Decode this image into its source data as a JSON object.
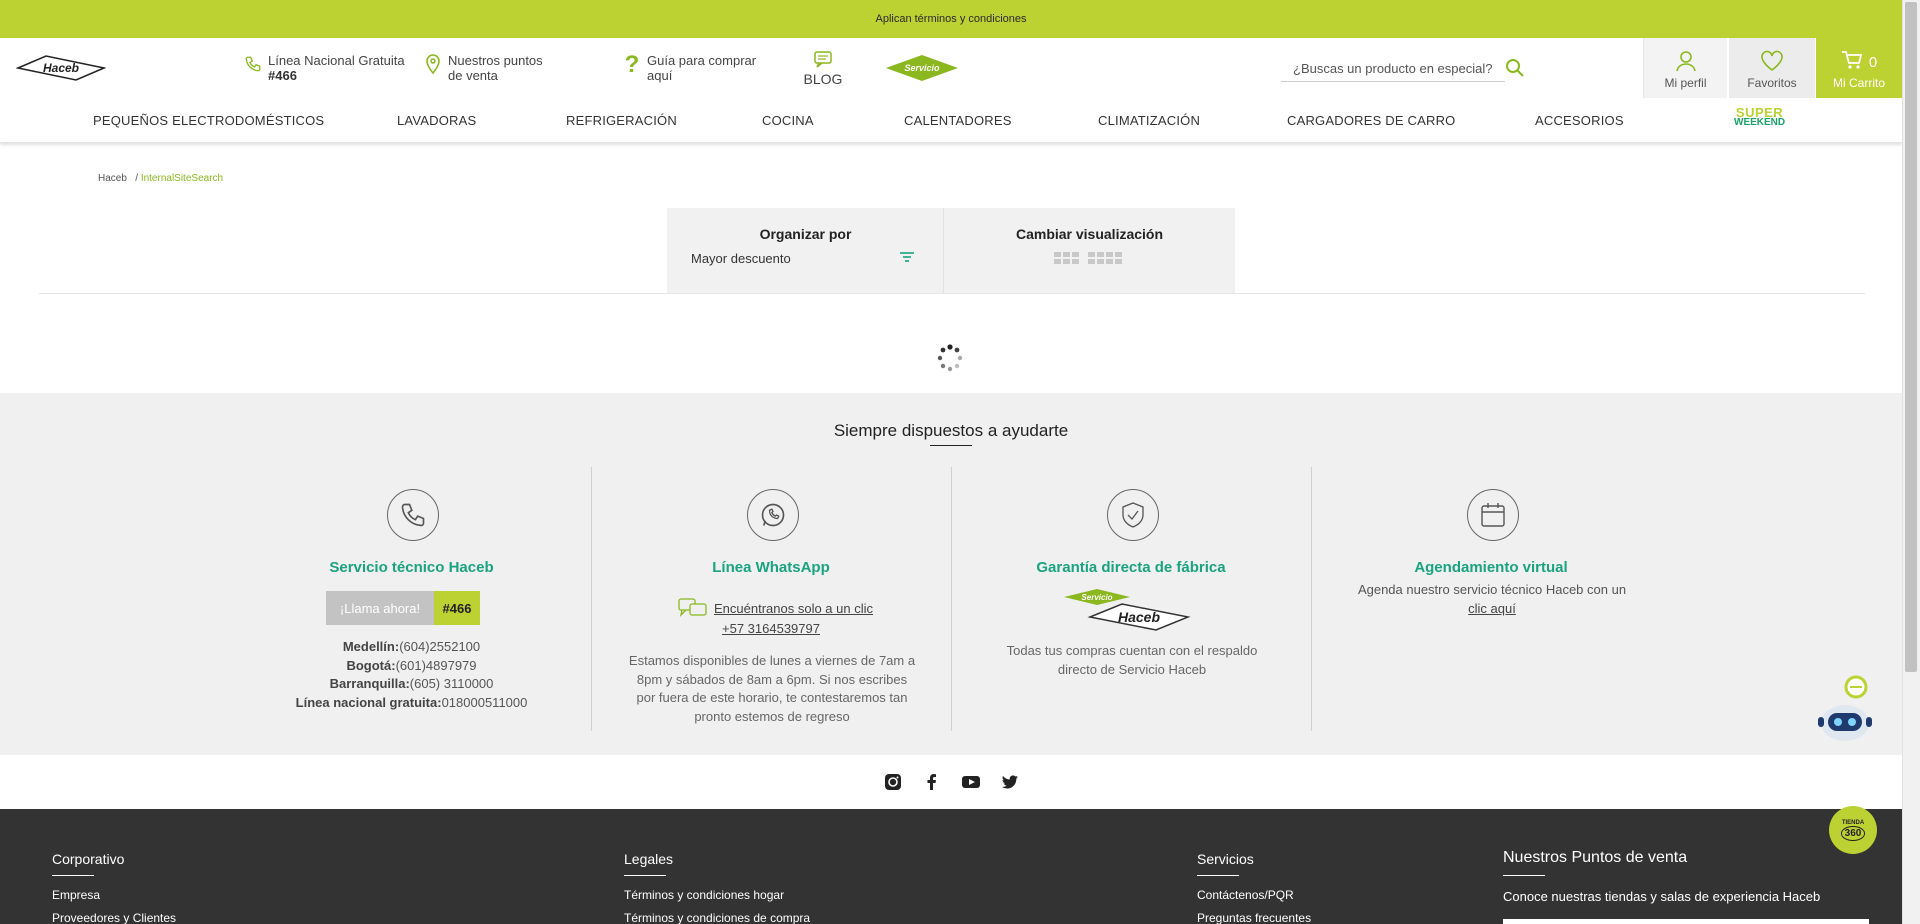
{
  "topbar": {
    "text": "Aplican términos y condiciones"
  },
  "header": {
    "logo_text": "Haceb",
    "linea_line1": "Línea Nacional Gratuita",
    "linea_line2": "#466",
    "puntos_line1": "Nuestros puntos",
    "puntos_line2": "de venta",
    "guia_line1": "Guía para comprar",
    "guia_line2": "aquí",
    "blog": "BLOG",
    "servicio_badge": "Servicio",
    "search_placeholder": "¿Buscas un producto en especial?",
    "perfil": "Mi perfil",
    "favoritos": "Favoritos",
    "cart_count": "0",
    "cart_label": "Mi Carrito"
  },
  "nav": {
    "items": [
      "PEQUEÑOS ELECTRODOMÉSTICOS",
      "LAVADORAS",
      "REFRIGERACIÓN",
      "COCINA",
      "CALENTADORES",
      "CLIMATIZACIÓN",
      "CARGADORES DE CARRO",
      "ACCESORIOS"
    ],
    "super_line1": "SUPER",
    "super_line2": "WEEKEND"
  },
  "breadcrumb": {
    "home": "Haceb",
    "separator": "/",
    "current": "InternalSiteSearch"
  },
  "sort": {
    "title": "Organizar por",
    "value": "Mayor descuento",
    "view_title": "Cambiar visualización"
  },
  "help": {
    "title": "Siempre dispuestos a ayudarte",
    "servicio": {
      "title": "Servicio técnico Haceb",
      "call_label": "¡Llama ahora!",
      "call_number": "#466",
      "lines": [
        {
          "city": "Medellín:",
          "phone": "(604)2552100"
        },
        {
          "city": "Bogotá:",
          "phone": "(601)4897979"
        },
        {
          "city": "Barranquilla:",
          "phone": "(605) 3110000"
        },
        {
          "city": "Línea nacional gratuita:",
          "phone": "018000511000"
        }
      ]
    },
    "whatsapp": {
      "title": "Línea WhatsApp",
      "link": "Encuéntranos solo a un clic",
      "number": "+57 3164539797",
      "text": "Estamos disponibles de lunes a viernes de 7am a 8pm y sábados de 8am a 6pm. Si nos escribes por fuera de este horario, te contestaremos tan pronto estemos de regreso"
    },
    "garantia": {
      "title": "Garantía directa de fábrica",
      "logo_top": "Servicio",
      "logo_main": "Haceb",
      "text": "Todas tus compras cuentan con el respaldo directo de Servicio Haceb"
    },
    "agenda": {
      "title": "Agendamiento virtual",
      "text": "Agenda nuestro servicio técnico Haceb con un",
      "link": "clic aquí"
    }
  },
  "social": [
    "instagram-icon",
    "facebook-icon",
    "youtube-icon",
    "twitter-icon"
  ],
  "footer": {
    "corporativo": {
      "title": "Corporativo",
      "item1": "Empresa",
      "item2": "Proveedores y Clientes"
    },
    "legales": {
      "title": "Legales",
      "item1": "Términos y condiciones hogar",
      "item2": "Términos y condiciones de compra"
    },
    "servicios": {
      "title": "Servicios",
      "item1": "Contáctenos/PQR",
      "item2": "Preguntas frecuentes"
    },
    "puntos": {
      "title": "Nuestros Puntos de venta",
      "text": "Conoce nuestras tiendas y salas de experiencia Haceb"
    }
  },
  "tienda360": {
    "line1": "TIENDA",
    "line2": "360"
  },
  "colors": {
    "brand_green": "#bcd232",
    "accent_teal": "#1aa380",
    "footer_dark": "#333333"
  }
}
